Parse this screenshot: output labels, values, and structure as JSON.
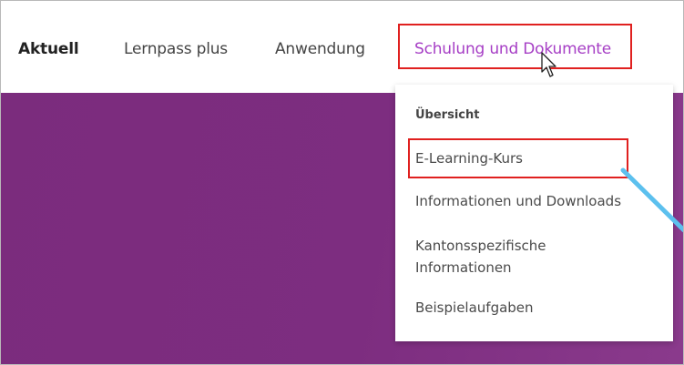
{
  "nav": {
    "items": [
      "Aktuell",
      "Lernpass plus",
      "Anwendung",
      "Schulung und Dokumente"
    ]
  },
  "dropdown": {
    "header": "Übersicht",
    "items": [
      "E-Learning-Kurs",
      "Informationen und Downloads",
      "Kantonsspezifische",
      "Informationen",
      "Beispielaufgaben"
    ]
  },
  "colors": {
    "accent": "#a63ec5",
    "hero": "#7d2d80",
    "annotation": "#e0201f",
    "arrow": "#5cc0ee"
  },
  "icons": [
    "mouse-cursor-icon",
    "annotation-arrow-icon"
  ]
}
